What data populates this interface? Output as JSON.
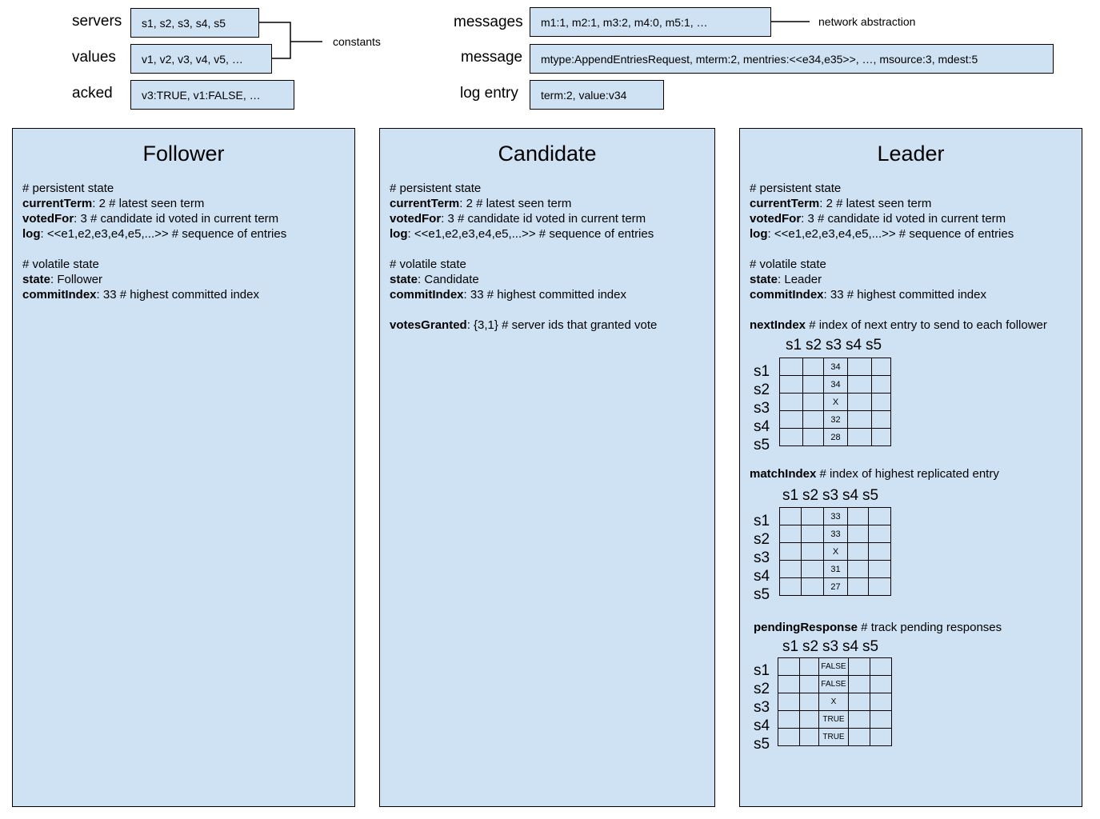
{
  "constants": {
    "servers": {
      "label": "servers",
      "value": "s1, s2, s3, s4, s5"
    },
    "values": {
      "label": "values",
      "value": "v1, v2, v3, v4, v5, …"
    },
    "acked": {
      "label": "acked",
      "value": "v3:TRUE, v1:FALSE, …"
    },
    "annotation": "constants"
  },
  "network": {
    "messages": {
      "label": "messages",
      "value": "m1:1, m2:1, m3:2, m4:0, m5:1, …"
    },
    "message": {
      "label": "message",
      "value": "mtype:AppendEntriesRequest, mterm:2, mentries:<<e34,e35>>, …, msource:3, mdest:5"
    },
    "log_entry": {
      "label": "log entry",
      "value": "term:2, value:v34"
    },
    "annotation": "network abstraction"
  },
  "common": {
    "persistent_header": "# persistent state",
    "currentTerm_key": "currentTerm",
    "currentTerm_rest": ": 2 # latest seen term",
    "votedFor_key": "votedFor",
    "votedFor_rest": ": 3 # candidate id voted in current term",
    "log_key": "log",
    "log_rest": ": <<e1,e2,e3,e4,e5,...>> # sequence of entries",
    "volatile_header": "# volatile state",
    "state_key": "state",
    "commitIndex_key": "commitIndex",
    "commitIndex_rest": ": 33 # highest committed index"
  },
  "follower": {
    "title": "Follower",
    "state_rest": ": Follower"
  },
  "candidate": {
    "title": "Candidate",
    "state_rest": ": Candidate",
    "votesGranted_key": "votesGranted",
    "votesGranted_rest": ": {3,1} # server ids that granted vote"
  },
  "leader": {
    "title": "Leader",
    "state_rest": ": Leader",
    "servers": [
      "s1",
      "s2",
      "s3",
      "s4",
      "s5"
    ],
    "nextIndex": {
      "key": "nextIndex",
      "rest": " # index of next entry to send to each follower",
      "s3_column": [
        "34",
        "34",
        "X",
        "32",
        "28"
      ]
    },
    "matchIndex": {
      "key": "matchIndex",
      "rest": " # index of highest replicated entry",
      "s3_column": [
        "33",
        "33",
        "X",
        "31",
        "27"
      ]
    },
    "pendingResponse": {
      "key": "pendingResponse",
      "rest": " # track pending responses",
      "s3_column": [
        "FALSE",
        "FALSE",
        "X",
        "TRUE",
        "TRUE"
      ]
    }
  }
}
